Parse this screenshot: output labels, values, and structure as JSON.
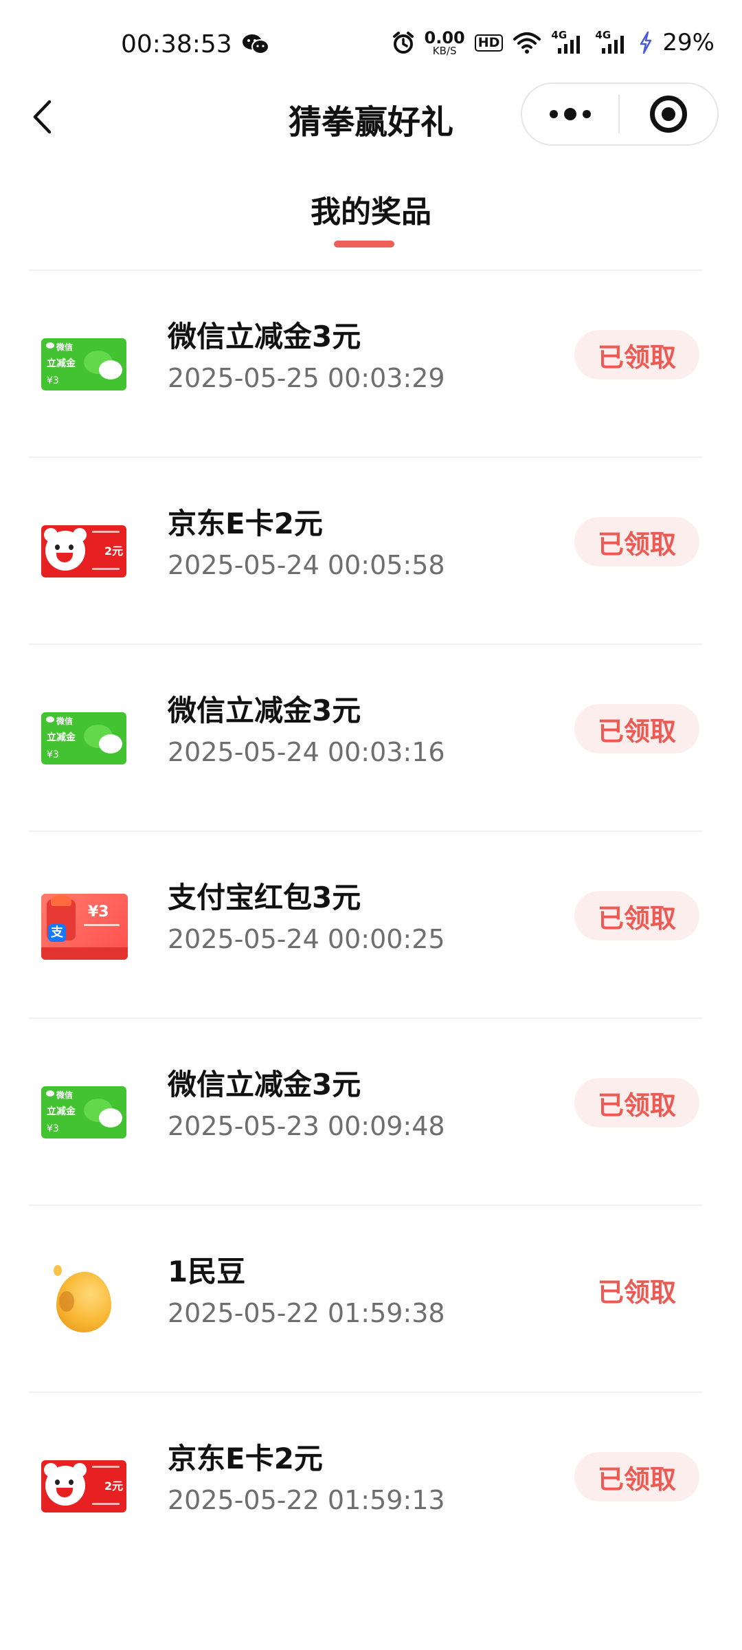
{
  "status_bar": {
    "time": "00:38:53",
    "net_speed_value": "0.00",
    "net_speed_unit": "KB/S",
    "hd_badge": "HD",
    "signal_1_label": "4G",
    "signal_2_label": "4G",
    "battery": "29%"
  },
  "header": {
    "title": "猜拳赢好礼"
  },
  "tab": {
    "label": "我的奖品",
    "accent_color": "#ec6057"
  },
  "prizes": [
    {
      "name": "微信立减金3元",
      "time": "2025-05-25 00:03:29",
      "status": "已领取",
      "thumb": "wechat-card",
      "card_brand": "微信",
      "card_title": "立减金",
      "card_value": "¥3"
    },
    {
      "name": "京东E卡2元",
      "time": "2025-05-24 00:05:58",
      "status": "已领取",
      "thumb": "jd-card",
      "card_value": "2元"
    },
    {
      "name": "微信立减金3元",
      "time": "2025-05-24 00:03:16",
      "status": "已领取",
      "thumb": "wechat-card",
      "card_brand": "微信",
      "card_title": "立减金",
      "card_value": "¥3"
    },
    {
      "name": "支付宝红包3元",
      "time": "2025-05-24 00:00:25",
      "status": "已领取",
      "thumb": "alipay-card",
      "card_value": "¥3"
    },
    {
      "name": "微信立减金3元",
      "time": "2025-05-23 00:09:48",
      "status": "已领取",
      "thumb": "wechat-card",
      "card_brand": "微信",
      "card_title": "立减金",
      "card_value": "¥3"
    },
    {
      "name": "1民豆",
      "time": "2025-05-22 01:59:38",
      "status": "已领取",
      "thumb": "bean"
    },
    {
      "name": "京东E卡2元",
      "time": "2025-05-22 01:59:13",
      "status": "已领取",
      "thumb": "jd-card",
      "card_value": "2元"
    }
  ],
  "colors": {
    "status_text": "#ec5b53",
    "status_bg": "#fdeeee",
    "wechat_green": "#43c331",
    "jd_red": "#e72021"
  }
}
